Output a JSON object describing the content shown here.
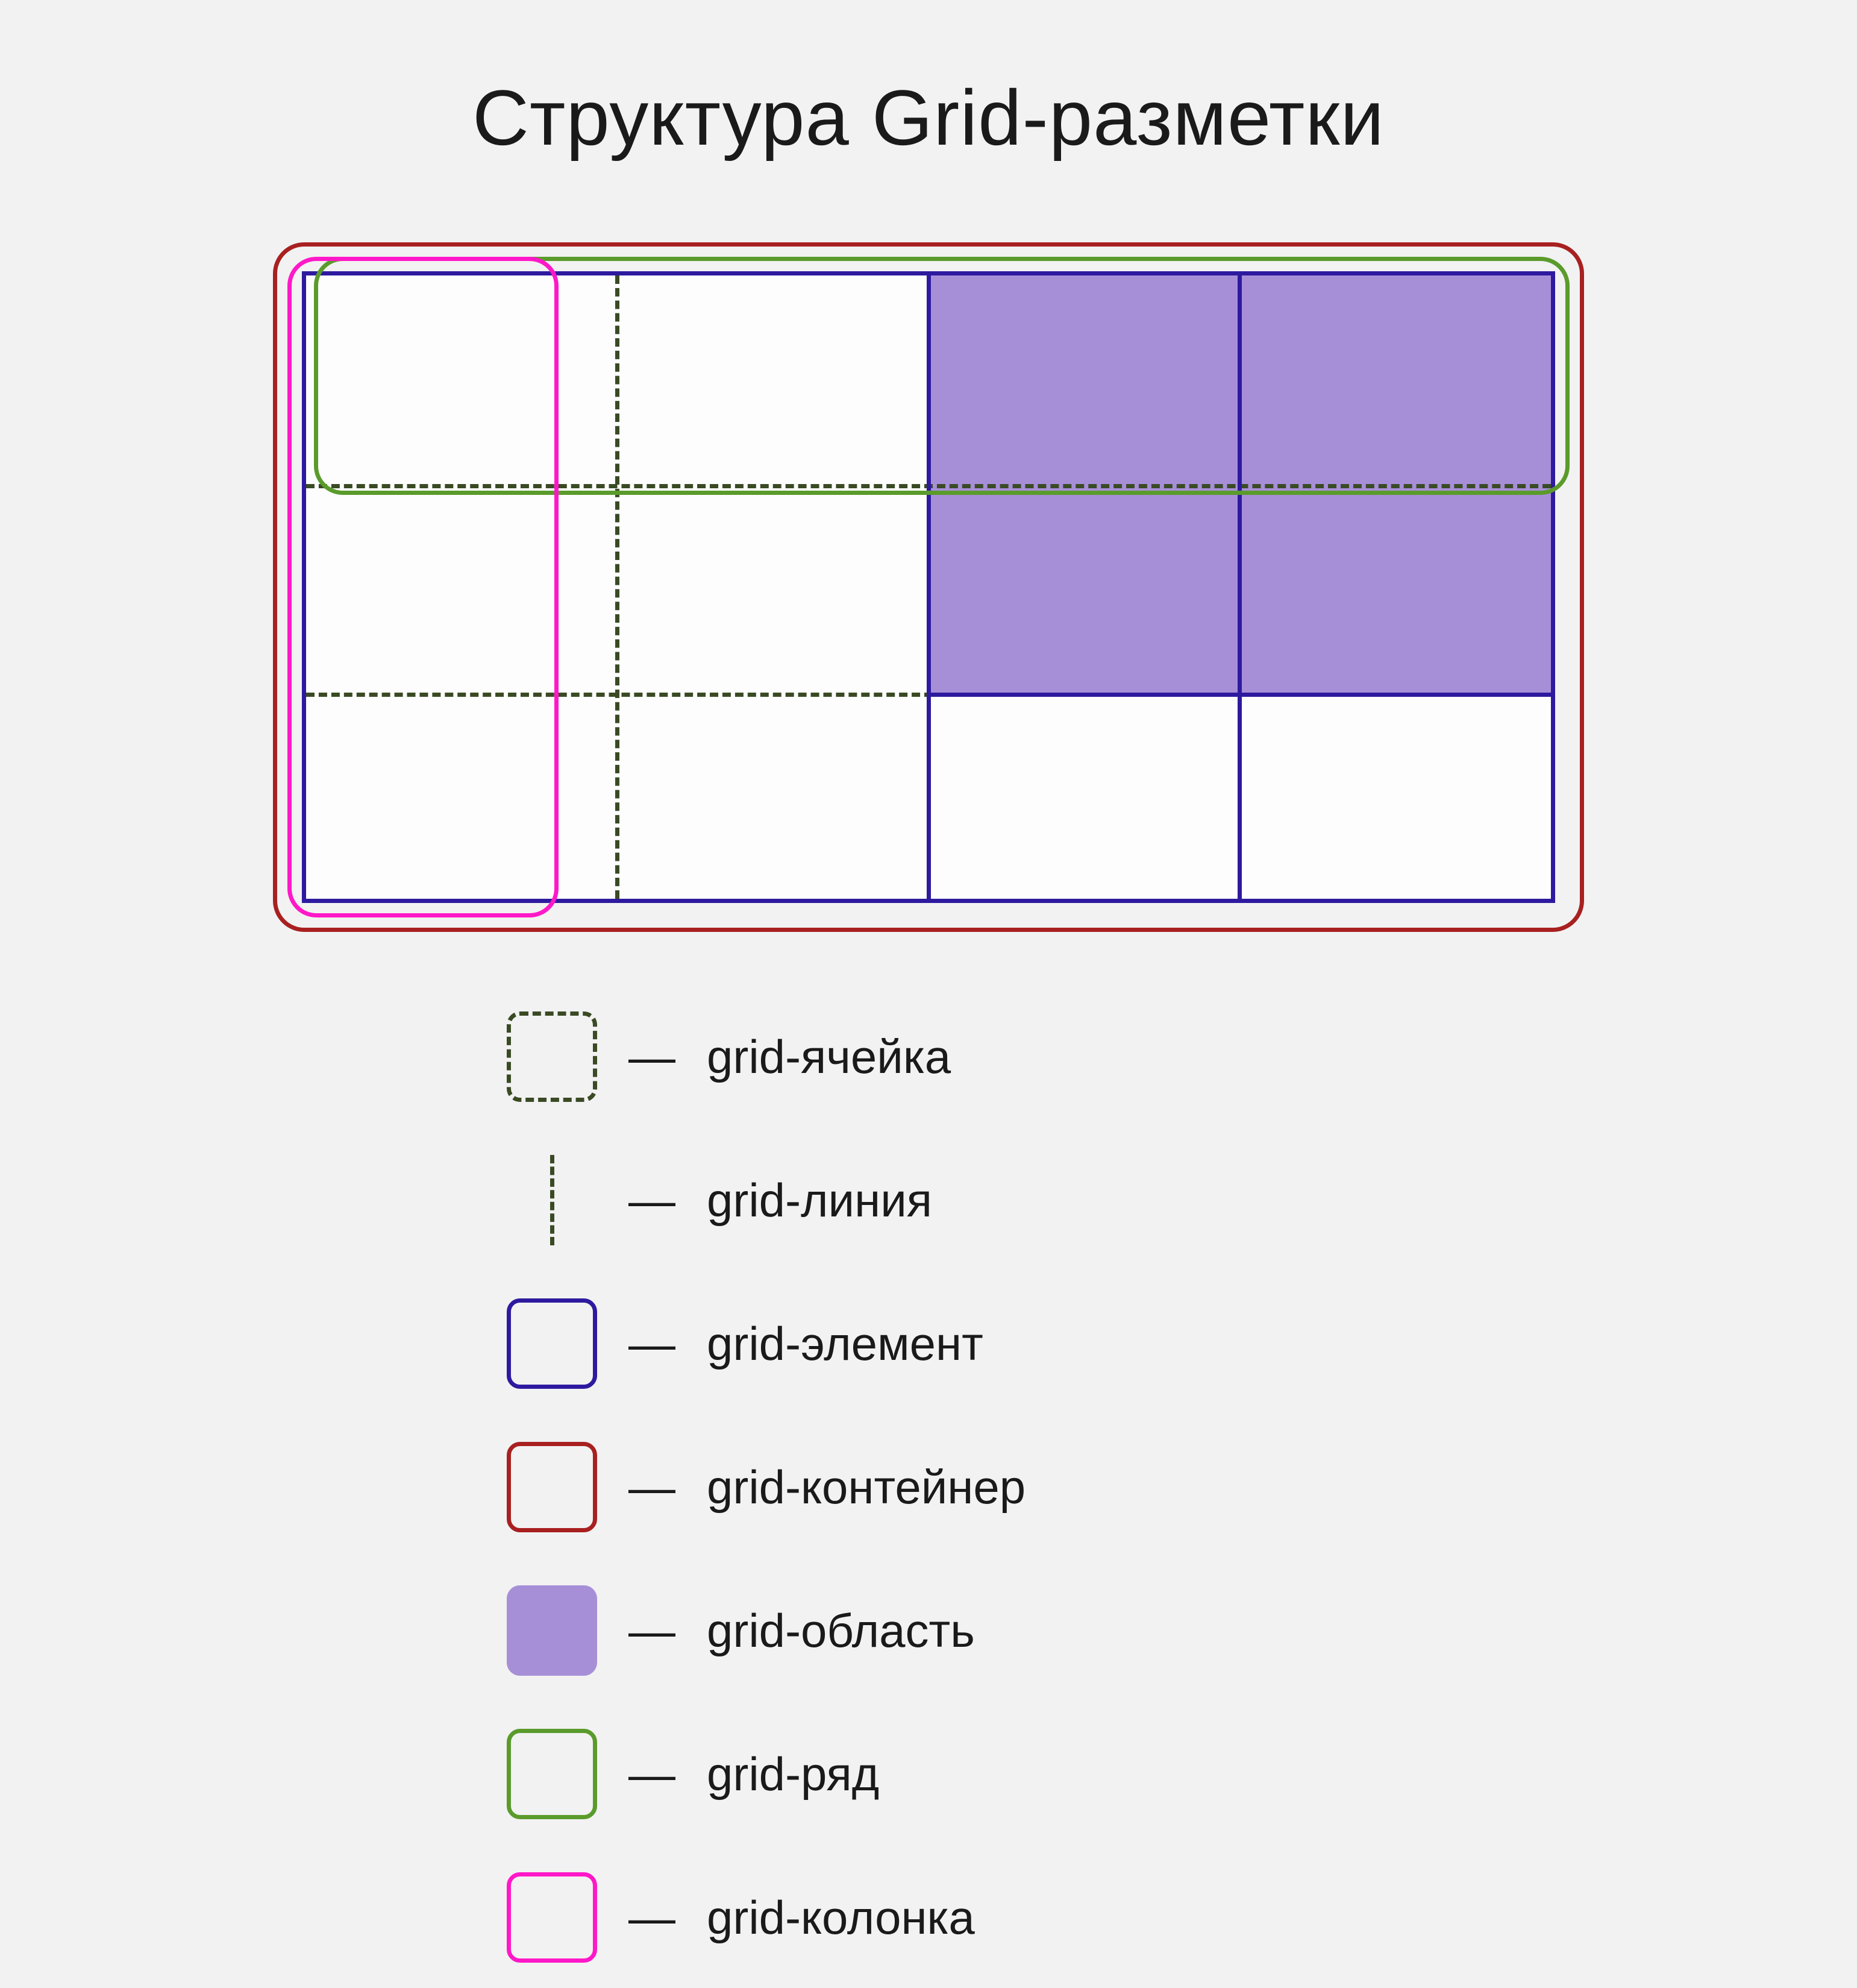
{
  "title": "Структура Grid-разметки",
  "diagram": {
    "columns": 4,
    "rows": 3,
    "area": {
      "colStart": 3,
      "colEnd": 5,
      "rowStart": 1,
      "rowEnd": 3
    },
    "highlightRow": 1,
    "highlightColumn": 1
  },
  "legend": {
    "dash": "—",
    "items": [
      {
        "key": "cell",
        "label": "grid-ячейка"
      },
      {
        "key": "line",
        "label": "grid-линия"
      },
      {
        "key": "element",
        "label": "grid-элемент"
      },
      {
        "key": "container",
        "label": "grid-контейнер"
      },
      {
        "key": "area",
        "label": "grid-область"
      },
      {
        "key": "row",
        "label": "grid-ряд"
      },
      {
        "key": "column",
        "label": "grid-колонка"
      }
    ]
  },
  "colors": {
    "cellLine": "#3a4a24",
    "element": "#2e1a9f",
    "container": "#a82020",
    "area": "#a78fd8",
    "row": "#5a9b2b",
    "column": "#ff18c8"
  }
}
